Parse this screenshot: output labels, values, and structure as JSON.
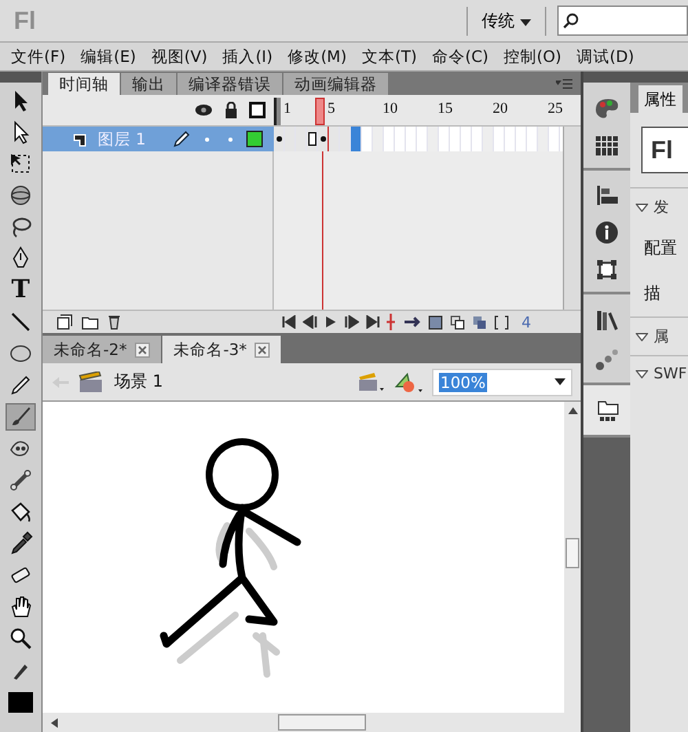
{
  "title_bar": {
    "logo": "Fl",
    "workspace": "传统"
  },
  "menu": [
    "文件(F)",
    "编辑(E)",
    "视图(V)",
    "插入(I)",
    "修改(M)",
    "文本(T)",
    "命令(C)",
    "控制(O)",
    "调试(D)"
  ],
  "tools": [
    {
      "kind": "selection",
      "selected": false
    },
    {
      "kind": "subselection",
      "selected": false
    },
    {
      "kind": "free-transform",
      "selected": false
    },
    {
      "kind": "rotation-3d",
      "selected": false
    },
    {
      "kind": "lasso",
      "selected": false
    },
    {
      "kind": "pen",
      "selected": false
    },
    {
      "kind": "text",
      "label": "T",
      "selected": false
    },
    {
      "kind": "line",
      "selected": false
    },
    {
      "kind": "oval",
      "selected": false
    },
    {
      "kind": "pencil",
      "selected": false
    },
    {
      "kind": "brush",
      "selected": true
    },
    {
      "kind": "deco",
      "selected": false
    },
    {
      "kind": "bone",
      "selected": false
    },
    {
      "kind": "bucket",
      "selected": false
    },
    {
      "kind": "eyedropper",
      "selected": false
    },
    {
      "kind": "eraser",
      "selected": false
    },
    {
      "kind": "hand",
      "selected": false
    },
    {
      "kind": "zoom",
      "selected": false
    },
    {
      "kind": "stroke-color",
      "selected": false
    },
    {
      "kind": "fill-color",
      "selected": false
    }
  ],
  "timeline": {
    "tabs": [
      {
        "label": "时间轴",
        "selected": true
      },
      {
        "label": "输出",
        "selected": false
      },
      {
        "label": "编译器错误",
        "selected": false
      },
      {
        "label": "动画编辑器",
        "selected": false
      }
    ],
    "ruler": [
      "1",
      "5",
      "10",
      "15",
      "20",
      "25"
    ],
    "layers": [
      {
        "name": "图层 1",
        "selected": true,
        "frames": [
          {
            "kind": "keyframe",
            "current": false
          },
          {
            "kind": "empty",
            "current": false
          },
          {
            "kind": "empty",
            "current": false
          },
          {
            "kind": "blank-keyframe",
            "current": false
          },
          {
            "kind": "keyframe",
            "current": true
          },
          {
            "kind": "empty",
            "current": false
          },
          {
            "kind": "empty",
            "current": false
          },
          {
            "kind": "selected",
            "current": false
          }
        ]
      }
    ],
    "current_frame": "4"
  },
  "documents": [
    {
      "label": "未命名-2*",
      "selected": false
    },
    {
      "label": "未命名-3*",
      "selected": true
    }
  ],
  "edit_bar": {
    "scene": "场景 1",
    "zoom": "100%"
  },
  "properties": {
    "tab": "属性",
    "logo": "Fl",
    "sections": [
      {
        "kind": "header",
        "label": "发"
      },
      {
        "kind": "text",
        "label": "配置"
      },
      {
        "kind": "text",
        "label": "描"
      },
      {
        "kind": "header",
        "label": "属"
      },
      {
        "kind": "header",
        "label": "SWF"
      }
    ]
  }
}
